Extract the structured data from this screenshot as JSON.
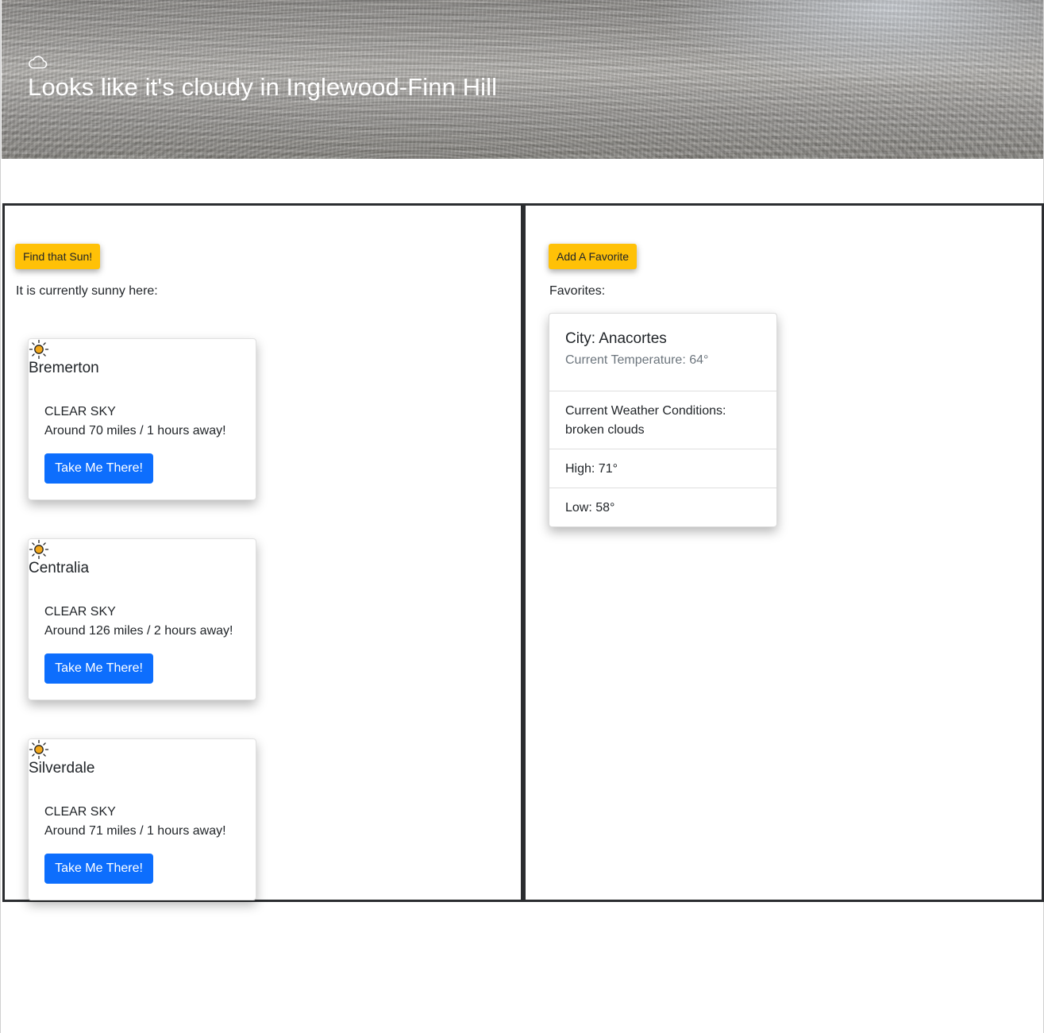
{
  "hero": {
    "icon": "cloud-icon",
    "title": "Looks like it's cloudy in Inglewood-Finn Hill"
  },
  "sunny": {
    "button_label": "Find that Sun!",
    "status_text": "It is currently sunny here:",
    "take_me_label": "Take Me There!",
    "icon": "sun-icon",
    "cards": [
      {
        "city": "Bremerton",
        "condition": "CLEAR SKY",
        "distance": "Around 70 miles / 1 hours away!"
      },
      {
        "city": "Centralia",
        "condition": "CLEAR SKY",
        "distance": "Around 126 miles / 2 hours away!"
      },
      {
        "city": "Silverdale",
        "condition": "CLEAR SKY",
        "distance": "Around 71 miles / 1 hours away!"
      }
    ]
  },
  "favorites": {
    "button_label": "Add A Favorite",
    "heading": "Favorites:",
    "card": {
      "city": "City: Anacortes",
      "temperature": "Current Temperature: 64°",
      "conditions_label": "Current Weather Conditions:",
      "conditions_value": "broken clouds",
      "high": "High: 71°",
      "low": "Low: 58°"
    }
  },
  "colors": {
    "yellow_button": "#ffc107",
    "blue_button": "#0d6efd",
    "panel_border": "#2b2d30",
    "sun_fill": "#f2a71b"
  }
}
